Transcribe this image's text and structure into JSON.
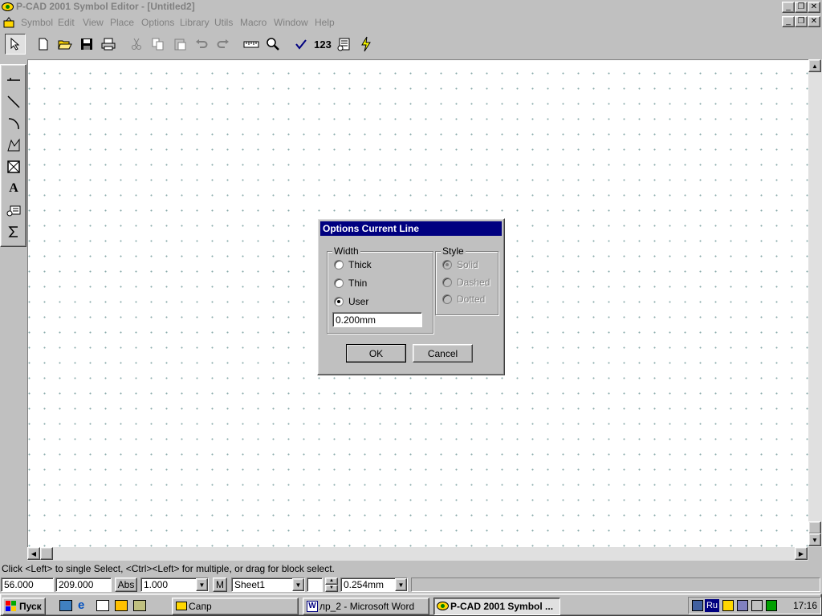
{
  "app": {
    "title": "P-CAD 2001 Symbol Editor - [Untitled2]"
  },
  "menu": [
    {
      "label": "Symbol"
    },
    {
      "label": "Edit"
    },
    {
      "label": "View"
    },
    {
      "label": "Place"
    },
    {
      "label": "Options"
    },
    {
      "label": "Library"
    },
    {
      "label": "Utils"
    },
    {
      "label": "Macro"
    },
    {
      "label": "Window"
    },
    {
      "label": "Help"
    }
  ],
  "toolbar": {
    "number_button": "123"
  },
  "lefttools_text_glyph": "A",
  "status": {
    "message": "Click <Left> to single Select, <Ctrl><Left> for multiple, or drag for block select."
  },
  "bottombar": {
    "x_coord": "56.000",
    "y_coord": "209.000",
    "abs_label": "Abs",
    "zoom": "1.000",
    "m_label": "M",
    "sheet": "Sheet1",
    "line_width": "0.254mm"
  },
  "dialog": {
    "title": "Options Current Line",
    "width_group": "Width",
    "style_group": "Style",
    "width_options": [
      "Thick",
      "Thin",
      "User"
    ],
    "width_selected": "User",
    "user_value": "0.200mm",
    "style_options": [
      "Solid",
      "Dashed",
      "Dotted"
    ],
    "ok_label": "OK",
    "cancel_label": "Cancel"
  },
  "taskbar": {
    "start_label": "Пуск",
    "tasks": [
      {
        "label": "Сапр"
      },
      {
        "label": "лр_2 - Microsoft Word"
      },
      {
        "label": "P-CAD 2001 Symbol ..."
      }
    ],
    "tray_lang": "Ru",
    "clock": "17:16"
  }
}
